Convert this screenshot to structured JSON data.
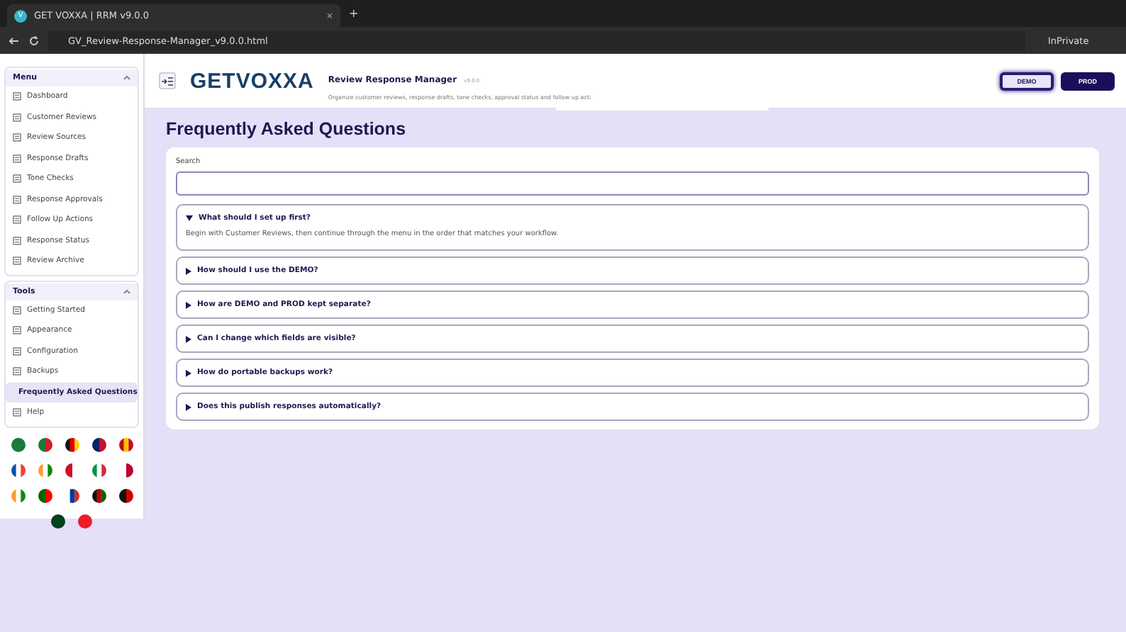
{
  "browser": {
    "favicon": "V",
    "tab_title": "GET VOXXA | RRM v9.0.0",
    "new_tab": "+",
    "close": "×",
    "address": "GV_Review-Response-Manager_v9.0.0.html",
    "profile": "InPrivate"
  },
  "header": {
    "logo": "GETVOXXA",
    "app_name": "Review Response Manager",
    "version": "v9.0.0",
    "subtitle": "Organize customer reviews, response drafts, tone checks, approval status and follow up acti",
    "env_buttons": [
      {
        "label": "DEMO",
        "selected": true
      },
      {
        "label": "PROD",
        "selected": false
      }
    ]
  },
  "sidebar": {
    "sections": [
      {
        "title": "Menu",
        "expanded": true,
        "items": [
          {
            "label": "Dashboard",
            "selected": false
          },
          {
            "label": "Customer Reviews",
            "selected": false
          },
          {
            "label": "Review Sources",
            "selected": false
          },
          {
            "label": "Response Drafts",
            "selected": false
          },
          {
            "label": "Tone Checks",
            "selected": false
          },
          {
            "label": "Response Approvals",
            "selected": false
          },
          {
            "label": "Follow Up Actions",
            "selected": false
          },
          {
            "label": "Response Status",
            "selected": false
          },
          {
            "label": "Review Archive",
            "selected": false
          }
        ]
      },
      {
        "title": "Tools",
        "expanded": true,
        "items": [
          {
            "label": "Getting Started",
            "selected": false
          },
          {
            "label": "Appearance",
            "selected": false
          },
          {
            "label": "Configuration",
            "selected": false
          },
          {
            "label": "Backups",
            "selected": false
          },
          {
            "label": "Frequently Asked Questions",
            "selected": true
          },
          {
            "label": "Help",
            "selected": false
          }
        ]
      }
    ]
  },
  "page": {
    "title": "Frequently Asked Questions",
    "search": {
      "label": "Search"
    },
    "faqs": [
      {
        "question": "What should I set up first?",
        "expanded": true,
        "answer": "Begin with Customer Reviews, then continue through the menu in the order that matches your workflow."
      },
      {
        "question": "How should I use the DEMO?",
        "expanded": false
      },
      {
        "question": "How are DEMO and PROD kept separate?",
        "expanded": false
      },
      {
        "question": "Can I change which fields are visible?",
        "expanded": false
      },
      {
        "question": "How do portable backups work?",
        "expanded": false
      },
      {
        "question": "Does this publish responses automatically?",
        "expanded": false
      }
    ]
  }
}
